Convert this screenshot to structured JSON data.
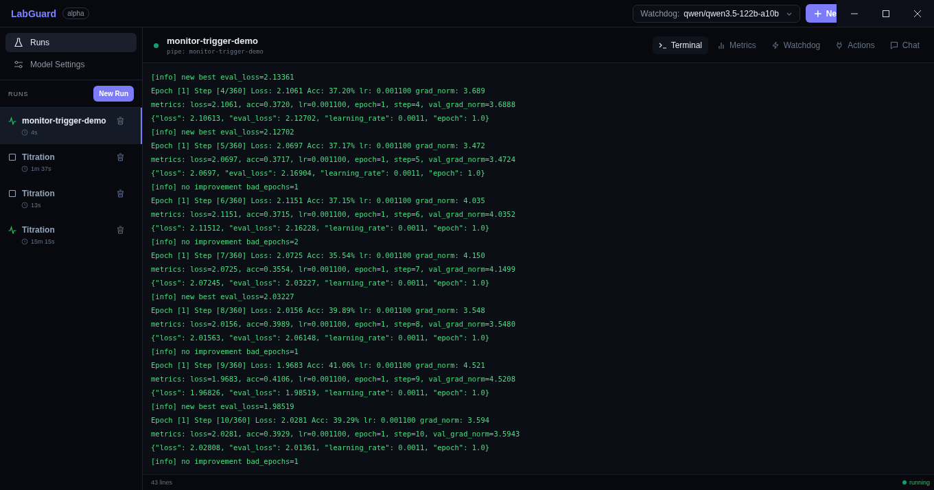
{
  "app": {
    "name": "LabGuard",
    "badge": "alpha"
  },
  "watchdog": {
    "label": "Watchdog:",
    "model": "qwen/qwen3.5-122b-a10b"
  },
  "new_button": {
    "label": "Ne"
  },
  "nav": [
    {
      "label": "Runs",
      "kind": "flask",
      "selected": true
    },
    {
      "label": "Model Settings",
      "kind": "sliders",
      "selected": false
    }
  ],
  "runs_section": {
    "title": "RUNS",
    "button": "New Run"
  },
  "runs": [
    {
      "name": "monitor-trigger-demo",
      "duration": "4s",
      "kind": "active",
      "selected": true
    },
    {
      "name": "Titration",
      "duration": "1m 37s",
      "kind": "stopped",
      "selected": false
    },
    {
      "name": "Titration",
      "duration": "13s",
      "kind": "stopped",
      "selected": false
    },
    {
      "name": "Titration",
      "duration": "15m 15s",
      "kind": "active",
      "selected": false
    }
  ],
  "run_header": {
    "title": "monitor-trigger-demo",
    "subtitle": "pipe: monitor-trigger-demo"
  },
  "tabs": [
    {
      "label": "Terminal",
      "kind": "terminal",
      "selected": true
    },
    {
      "label": "Metrics",
      "kind": "bars",
      "selected": false
    },
    {
      "label": "Watchdog",
      "kind": "bolt",
      "selected": false
    },
    {
      "label": "Actions",
      "kind": "plug",
      "selected": false
    },
    {
      "label": "Chat",
      "kind": "chat",
      "selected": false
    }
  ],
  "log_lines": [
    "[info] new best eval_loss=2.13361",
    "Epoch [1] Step [4/360] Loss: 2.1061 Acc: 37.20% lr: 0.001100 grad_norm: 3.689",
    "metrics: loss=2.1061, acc=0.3720, lr=0.001100, epoch=1, step=4, val_grad_norm=3.6888",
    "{\"loss\": 2.10613, \"eval_loss\": 2.12702, \"learning_rate\": 0.0011, \"epoch\": 1.0}",
    "[info] new best eval_loss=2.12702",
    "Epoch [1] Step [5/360] Loss: 2.0697 Acc: 37.17% lr: 0.001100 grad_norm: 3.472",
    "metrics: loss=2.0697, acc=0.3717, lr=0.001100, epoch=1, step=5, val_grad_norm=3.4724",
    "{\"loss\": 2.0697, \"eval_loss\": 2.16904, \"learning_rate\": 0.0011, \"epoch\": 1.0}",
    "[info] no improvement bad_epochs=1",
    "Epoch [1] Step [6/360] Loss: 2.1151 Acc: 37.15% lr: 0.001100 grad_norm: 4.035",
    "metrics: loss=2.1151, acc=0.3715, lr=0.001100, epoch=1, step=6, val_grad_norm=4.0352",
    "{\"loss\": 2.11512, \"eval_loss\": 2.16228, \"learning_rate\": 0.0011, \"epoch\": 1.0}",
    "[info] no improvement bad_epochs=2",
    "Epoch [1] Step [7/360] Loss: 2.0725 Acc: 35.54% lr: 0.001100 grad_norm: 4.150",
    "metrics: loss=2.0725, acc=0.3554, lr=0.001100, epoch=1, step=7, val_grad_norm=4.1499",
    "{\"loss\": 2.07245, \"eval_loss\": 2.03227, \"learning_rate\": 0.0011, \"epoch\": 1.0}",
    "[info] new best eval_loss=2.03227",
    "Epoch [1] Step [8/360] Loss: 2.0156 Acc: 39.89% lr: 0.001100 grad_norm: 3.548",
    "metrics: loss=2.0156, acc=0.3989, lr=0.001100, epoch=1, step=8, val_grad_norm=3.5480",
    "{\"loss\": 2.01563, \"eval_loss\": 2.06148, \"learning_rate\": 0.0011, \"epoch\": 1.0}",
    "[info] no improvement bad_epochs=1",
    "Epoch [1] Step [9/360] Loss: 1.9683 Acc: 41.06% lr: 0.001100 grad_norm: 4.521",
    "metrics: loss=1.9683, acc=0.4106, lr=0.001100, epoch=1, step=9, val_grad_norm=4.5208",
    "{\"loss\": 1.96826, \"eval_loss\": 1.98519, \"learning_rate\": 0.0011, \"epoch\": 1.0}",
    "[info] new best eval_loss=1.98519",
    "Epoch [1] Step [10/360] Loss: 2.0281 Acc: 39.29% lr: 0.001100 grad_norm: 3.594",
    "metrics: loss=2.0281, acc=0.3929, lr=0.001100, epoch=1, step=10, val_grad_norm=3.5943",
    "{\"loss\": 2.02808, \"eval_loss\": 2.01361, \"learning_rate\": 0.0011, \"epoch\": 1.0}",
    "[info] no improvement bad_epochs=1"
  ],
  "status": {
    "lines": "43 lines",
    "state": "running"
  }
}
